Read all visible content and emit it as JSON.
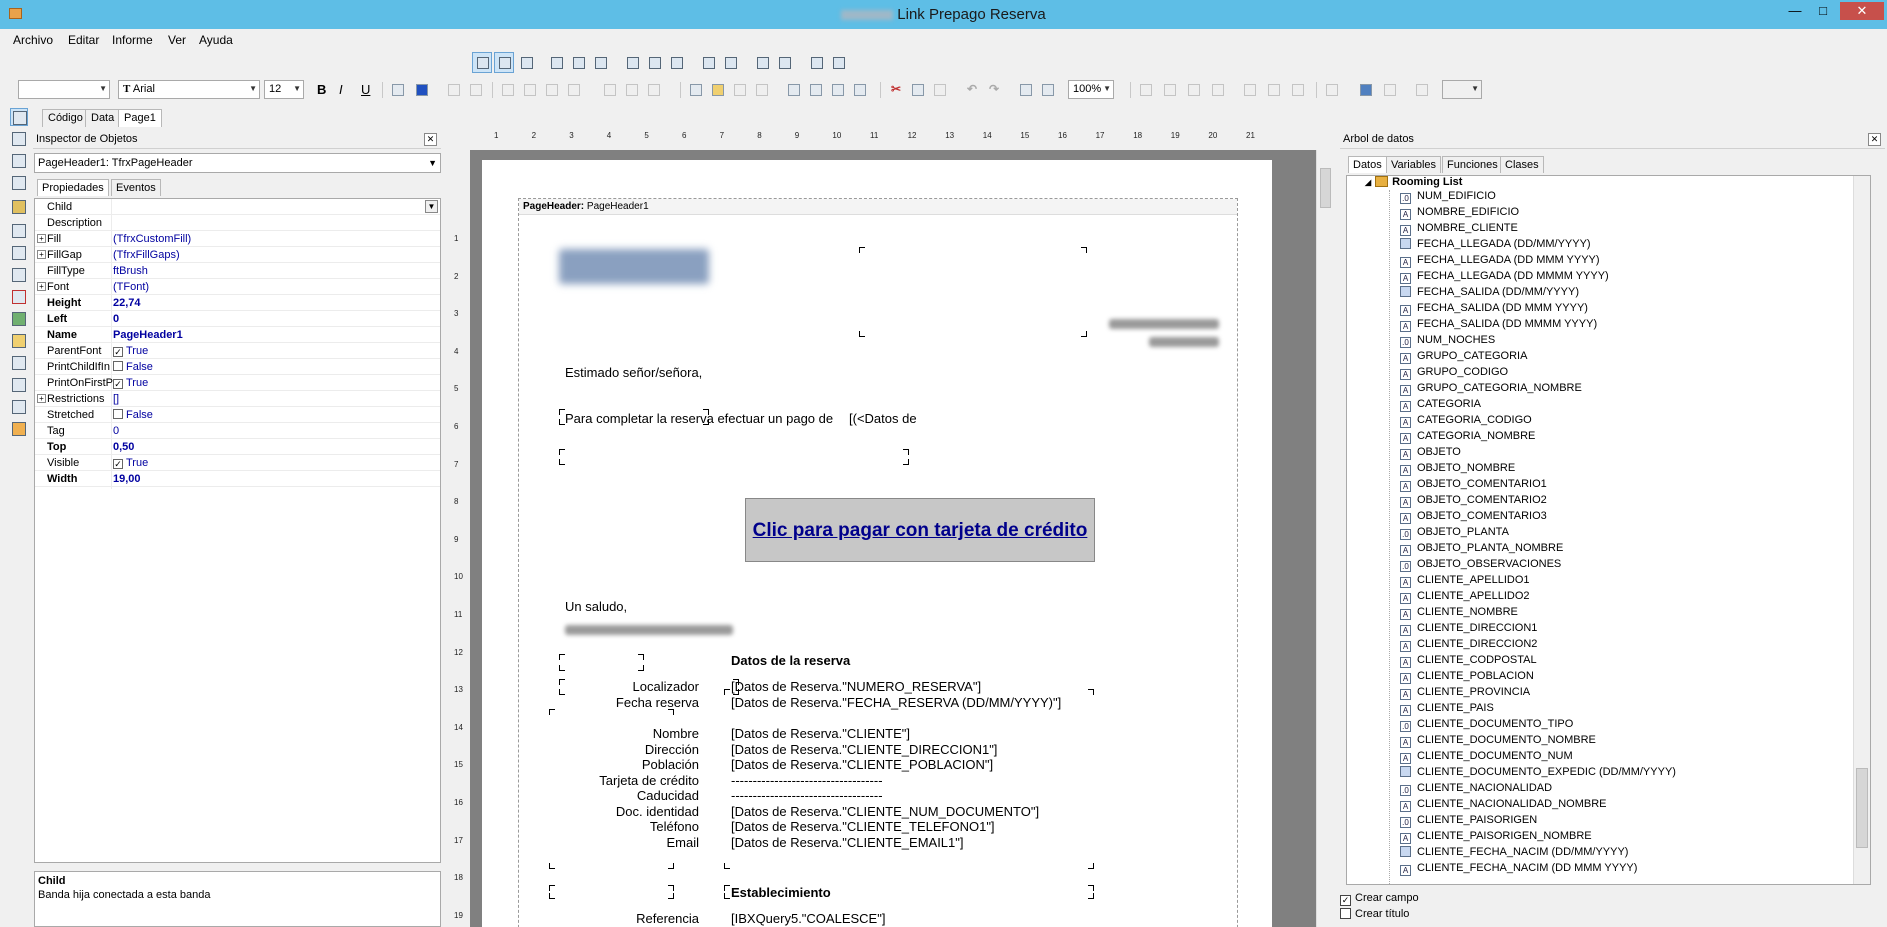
{
  "window": {
    "title": "Link Prepago Reserva",
    "controls": {
      "minimize": "—",
      "maximize": "□",
      "close": "✕"
    }
  },
  "menu": [
    "Archivo",
    "Editar",
    "Informe",
    "Ver",
    "Ayuda"
  ],
  "format_toolbar": {
    "style_value": "",
    "font_name": "Arial",
    "font_size": "12",
    "zoom": "100%",
    "bold": "B",
    "italic": "I",
    "underline": "U"
  },
  "designer_tabs": [
    "Código",
    "Data",
    "Page1"
  ],
  "inspector": {
    "title": "Inspector de Objetos",
    "object_selector": "PageHeader1: TfrxPageHeader",
    "tabs": [
      "Propiedades",
      "Eventos"
    ],
    "properties": [
      {
        "name": "Child",
        "value": "",
        "expand": false,
        "bold": false
      },
      {
        "name": "Description",
        "value": "",
        "expand": false,
        "bold": false
      },
      {
        "name": "Fill",
        "value": "(TfrxCustomFill)",
        "expand": true,
        "bold": false
      },
      {
        "name": "FillGap",
        "value": "(TfrxFillGaps)",
        "expand": true,
        "bold": false
      },
      {
        "name": "FillType",
        "value": "ftBrush",
        "expand": false,
        "bold": false
      },
      {
        "name": "Font",
        "value": "(TFont)",
        "expand": true,
        "bold": false
      },
      {
        "name": "Height",
        "value": "22,74",
        "expand": false,
        "bold": true
      },
      {
        "name": "Left",
        "value": "0",
        "expand": false,
        "bold": true
      },
      {
        "name": "Name",
        "value": "PageHeader1",
        "expand": false,
        "bold": true
      },
      {
        "name": "ParentFont",
        "value": "True",
        "expand": false,
        "bold": false,
        "check": true
      },
      {
        "name": "PrintChildIfIn",
        "value": "False",
        "expand": false,
        "bold": false,
        "check": false
      },
      {
        "name": "PrintOnFirstP",
        "value": "True",
        "expand": false,
        "bold": false,
        "check": true
      },
      {
        "name": "Restrictions",
        "value": "[]",
        "expand": true,
        "bold": false
      },
      {
        "name": "Stretched",
        "value": "False",
        "expand": false,
        "bold": false,
        "check": false
      },
      {
        "name": "Tag",
        "value": "0",
        "expand": false,
        "bold": false
      },
      {
        "name": "Top",
        "value": "0,50",
        "expand": false,
        "bold": true
      },
      {
        "name": "Visible",
        "value": "True",
        "expand": false,
        "bold": false,
        "check": true
      },
      {
        "name": "Width",
        "value": "19,00",
        "expand": false,
        "bold": true
      }
    ],
    "description_title": "Child",
    "description_text": "Banda hija conectada a esta banda"
  },
  "ruler": {
    "h": [
      "1",
      "2",
      "3",
      "4",
      "5",
      "6",
      "7",
      "8",
      "9",
      "10",
      "11",
      "12",
      "13",
      "14",
      "15",
      "16",
      "17",
      "18",
      "19",
      "20",
      "21"
    ],
    "v": [
      "1",
      "2",
      "3",
      "4",
      "5",
      "6",
      "7",
      "8",
      "9",
      "10",
      "11",
      "12",
      "13",
      "14",
      "15",
      "16",
      "17",
      "18",
      "19"
    ]
  },
  "report": {
    "band_label": "PageHeader:",
    "band_name": "PageHeader1",
    "greeting": "Estimado señor/señora,",
    "payment_text": "Para completar la reserva efectuar un pago de",
    "payment_field": "[(<Datos de",
    "pay_button": "Clic para pagar con tarjeta de crédito",
    "closing": "Un saludo,",
    "section1_title": "Datos de la reserva",
    "rows1": [
      {
        "label": "Localizador",
        "value": "[Datos de Reserva.\"NUMERO_RESERVA\"]"
      },
      {
        "label": "Fecha reserva",
        "value": "[Datos de Reserva.\"FECHA_RESERVA (DD/MM/YYYY)\"]"
      },
      {
        "label": "Nombre",
        "value": "[Datos de Reserva.\"CLIENTE\"]"
      },
      {
        "label": "Dirección",
        "value": "[Datos de Reserva.\"CLIENTE_DIRECCION1\"]"
      },
      {
        "label": "Población",
        "value": "[Datos de Reserva.\"CLIENTE_POBLACION\"]"
      },
      {
        "label": "Tarjeta de crédito",
        "value": "-----------------------------------"
      },
      {
        "label": "Caducidad",
        "value": "-----------------------------------"
      },
      {
        "label": "Doc. identidad",
        "value": "[Datos de Reserva.\"CLIENTE_NUM_DOCUMENTO\"]"
      },
      {
        "label": "Teléfono",
        "value": "[Datos de Reserva.\"CLIENTE_TELEFONO1\"]"
      },
      {
        "label": "Email",
        "value": "[Datos de Reserva.\"CLIENTE_EMAIL1\"]"
      }
    ],
    "section2_title": "Establecimiento",
    "rows2": [
      {
        "label": "Referencia",
        "value": "[IBXQuery5.\"COALESCE\"]"
      }
    ]
  },
  "tree": {
    "title": "Arbol de datos",
    "tabs": [
      "Datos",
      "Variables",
      "Funciones",
      "Clases"
    ],
    "root": "Rooming List",
    "fields": [
      {
        "name": "NUM_EDIFICIO",
        "icon": ".0"
      },
      {
        "name": "NOMBRE_EDIFICIO",
        "icon": "A"
      },
      {
        "name": "NOMBRE_CLIENTE",
        "icon": "A"
      },
      {
        "name": "FECHA_LLEGADA (DD/MM/YYYY)",
        "icon": "#"
      },
      {
        "name": "FECHA_LLEGADA (DD MMM YYYY)",
        "icon": "A"
      },
      {
        "name": "FECHA_LLEGADA (DD MMMM YYYY)",
        "icon": "A"
      },
      {
        "name": "FECHA_SALIDA (DD/MM/YYYY)",
        "icon": "#"
      },
      {
        "name": "FECHA_SALIDA (DD MMM YYYY)",
        "icon": "A"
      },
      {
        "name": "FECHA_SALIDA (DD MMMM YYYY)",
        "icon": "A"
      },
      {
        "name": "NUM_NOCHES",
        "icon": ".0"
      },
      {
        "name": "GRUPO_CATEGORIA",
        "icon": "A"
      },
      {
        "name": "GRUPO_CODIGO",
        "icon": "A"
      },
      {
        "name": "GRUPO_CATEGORIA_NOMBRE",
        "icon": "A"
      },
      {
        "name": "CATEGORIA",
        "icon": "A"
      },
      {
        "name": "CATEGORIA_CODIGO",
        "icon": "A"
      },
      {
        "name": "CATEGORIA_NOMBRE",
        "icon": "A"
      },
      {
        "name": "OBJETO",
        "icon": "A"
      },
      {
        "name": "OBJETO_NOMBRE",
        "icon": "A"
      },
      {
        "name": "OBJETO_COMENTARIO1",
        "icon": "A"
      },
      {
        "name": "OBJETO_COMENTARIO2",
        "icon": "A"
      },
      {
        "name": "OBJETO_COMENTARIO3",
        "icon": "A"
      },
      {
        "name": "OBJETO_PLANTA",
        "icon": ".0"
      },
      {
        "name": "OBJETO_PLANTA_NOMBRE",
        "icon": "A"
      },
      {
        "name": "OBJETO_OBSERVACIONES",
        "icon": ".0"
      },
      {
        "name": "CLIENTE_APELLIDO1",
        "icon": "A"
      },
      {
        "name": "CLIENTE_APELLIDO2",
        "icon": "A"
      },
      {
        "name": "CLIENTE_NOMBRE",
        "icon": "A"
      },
      {
        "name": "CLIENTE_DIRECCION1",
        "icon": "A"
      },
      {
        "name": "CLIENTE_DIRECCION2",
        "icon": "A"
      },
      {
        "name": "CLIENTE_CODPOSTAL",
        "icon": "A"
      },
      {
        "name": "CLIENTE_POBLACION",
        "icon": "A"
      },
      {
        "name": "CLIENTE_PROVINCIA",
        "icon": "A"
      },
      {
        "name": "CLIENTE_PAIS",
        "icon": "A"
      },
      {
        "name": "CLIENTE_DOCUMENTO_TIPO",
        "icon": ".0"
      },
      {
        "name": "CLIENTE_DOCUMENTO_NOMBRE",
        "icon": "A"
      },
      {
        "name": "CLIENTE_DOCUMENTO_NUM",
        "icon": "A"
      },
      {
        "name": "CLIENTE_DOCUMENTO_EXPEDIC (DD/MM/YYYY)",
        "icon": "#"
      },
      {
        "name": "CLIENTE_NACIONALIDAD",
        "icon": ".0"
      },
      {
        "name": "CLIENTE_NACIONALIDAD_NOMBRE",
        "icon": "A"
      },
      {
        "name": "CLIENTE_PAISORIGEN",
        "icon": ".0"
      },
      {
        "name": "CLIENTE_PAISORIGEN_NOMBRE",
        "icon": "A"
      },
      {
        "name": "CLIENTE_FECHA_NACIM (DD/MM/YYYY)",
        "icon": "#"
      },
      {
        "name": "CLIENTE_FECHA_NACIM (DD MMM YYYY)",
        "icon": "A"
      }
    ],
    "create_field": "Crear campo",
    "create_title": "Crear título"
  }
}
